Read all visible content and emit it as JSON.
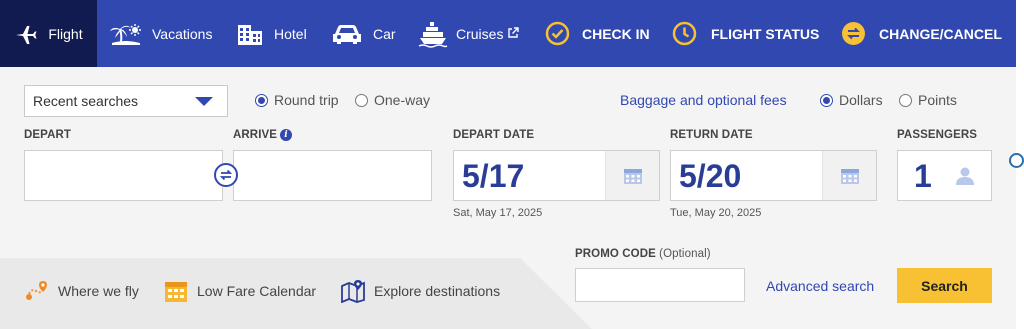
{
  "nav": {
    "tabs": [
      {
        "label": "Flight",
        "icon": "airplane-icon",
        "active": true
      },
      {
        "label": "Vacations",
        "icon": "palm-tree-icon"
      },
      {
        "label": "Hotel",
        "icon": "hotel-building-icon"
      },
      {
        "label": "Car",
        "icon": "car-icon"
      },
      {
        "label": "Cruises",
        "icon": "cruise-ship-icon"
      }
    ],
    "actions": [
      {
        "label": "CHECK IN",
        "icon": "checkmark-circle-icon"
      },
      {
        "label": "FLIGHT STATUS",
        "icon": "clock-icon"
      },
      {
        "label": "CHANGE/CANCEL",
        "icon": "swap-arrows-circle-icon"
      }
    ]
  },
  "form": {
    "recent_searches": "Recent searches",
    "trip_type": {
      "round_trip": "Round trip",
      "one_way": "One-way",
      "selected": "Round trip"
    },
    "baggage_link": "Baggage and optional fees",
    "currency": {
      "dollars": "Dollars",
      "points": "Points",
      "selected": "Dollars"
    },
    "depart_label": "DEPART",
    "arrive_label": "ARRIVE",
    "depart_date_label": "DEPART DATE",
    "depart_date_value": "5/17",
    "depart_date_sub": "Sat, May 17, 2025",
    "return_date_label": "RETURN DATE",
    "return_date_value": "5/20",
    "return_date_sub": "Tue, May 20, 2025",
    "passengers_label": "PASSENGERS",
    "passengers_value": "1",
    "promo_label": "PROMO CODE",
    "promo_optional": "(Optional)",
    "advanced_search": "Advanced search",
    "search_button": "Search"
  },
  "links": [
    {
      "label": "Where we fly",
      "icon": "route-map-icon"
    },
    {
      "label": "Low Fare Calendar",
      "icon": "calendar-icon"
    },
    {
      "label": "Explore destinations",
      "icon": "map-pin-icon"
    }
  ],
  "colors": {
    "nav_bg": "#3048b0",
    "active_tab": "#111b4f",
    "accent": "#f7c133",
    "text_blue": "#2a3d96"
  }
}
